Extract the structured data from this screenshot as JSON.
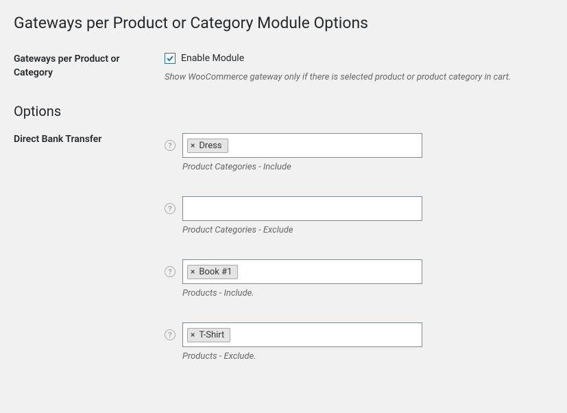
{
  "page": {
    "title": "Gateways per Product or Category Module Options"
  },
  "module": {
    "label": "Gateways per Product or Category",
    "enable_label": "Enable Module",
    "enabled": true,
    "description": "Show WooCommerce gateway only if there is selected product or product category in cart."
  },
  "options": {
    "title": "Options",
    "gateway_label": "Direct Bank Transfer",
    "fields": [
      {
        "caption": "Product Categories - Include",
        "tags": [
          "Dress"
        ]
      },
      {
        "caption": "Product Categories - Exclude",
        "tags": []
      },
      {
        "caption": "Products - Include.",
        "tags": [
          "Book #1"
        ]
      },
      {
        "caption": "Products - Exclude.",
        "tags": [
          "T-Shirt"
        ]
      }
    ]
  }
}
